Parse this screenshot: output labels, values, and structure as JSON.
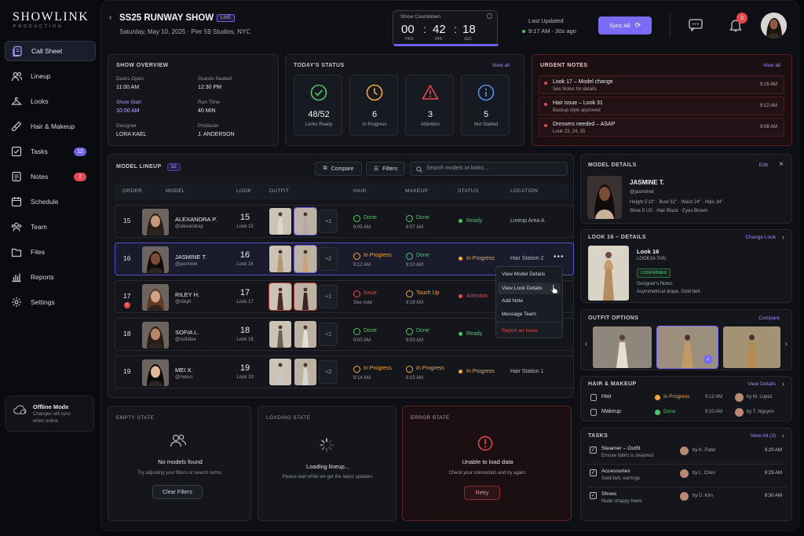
{
  "brand": {
    "name": "SHOWLINK",
    "sub": "PRODUCTION"
  },
  "sidebar": {
    "items": [
      {
        "label": "Call Sheet",
        "icon": "call-sheet-icon",
        "active": true
      },
      {
        "label": "Lineup",
        "icon": "users-icon"
      },
      {
        "label": "Looks",
        "icon": "hanger-icon"
      },
      {
        "label": "Hair & Makeup",
        "icon": "brush-icon"
      },
      {
        "label": "Tasks",
        "icon": "checkbox-icon",
        "badge": "12"
      },
      {
        "label": "Notes",
        "icon": "notes-icon",
        "badge": "2"
      },
      {
        "label": "Schedule",
        "icon": "calendar-icon"
      },
      {
        "label": "Team",
        "icon": "team-icon"
      },
      {
        "label": "Files",
        "icon": "folder-icon"
      },
      {
        "label": "Reports",
        "icon": "bar-chart-icon"
      },
      {
        "label": "Settings",
        "icon": "gear-icon"
      }
    ],
    "offline": {
      "title": "Offline Mode",
      "line1": "Changes will sync",
      "line2": "when online"
    }
  },
  "header": {
    "title": "SS25 RUNWAY SHOW",
    "live": "LIVE",
    "subtitle": "Saturday, May 10, 2025 · Pier 59 Studios, NYC",
    "countdown": {
      "label": "Show Countdown",
      "hrs": "00",
      "min": "42",
      "sec": "18",
      "hrs_label": "HRS",
      "min_label": "MIN",
      "sec_label": "SEC"
    },
    "updated": {
      "label": "Last Updated",
      "time": "9:17 AM · 30s ago"
    },
    "sync": "Sync All",
    "notif_count": "3"
  },
  "overview": {
    "title": "SHOW OVERVIEW",
    "fields": [
      {
        "label": "Doors Open",
        "value": "11:00 AM"
      },
      {
        "label": "Guests Seated",
        "value": "12:30 PM"
      },
      {
        "label": "Show Start",
        "value": "10:00 AM"
      },
      {
        "label": "Run Time",
        "value": "40 MIN"
      },
      {
        "label": "Designer",
        "value": "LORA KAEL"
      },
      {
        "label": "Producer",
        "value": "J. ANDERSON"
      }
    ]
  },
  "status": {
    "title": "TODAY'S STATUS",
    "link": "View all",
    "items": [
      {
        "value": "48/52",
        "label": "Looks Ready"
      },
      {
        "value": "6",
        "label": "In Progress"
      },
      {
        "value": "3",
        "label": "Attention"
      },
      {
        "value": "5",
        "label": "Not Started"
      }
    ]
  },
  "urgent": {
    "title": "URGENT NOTES",
    "link": "View all",
    "items": [
      {
        "title": "Look 17 – Model change",
        "sub": "See Notes for details",
        "time": "9:16 AM"
      },
      {
        "title": "Hair issue – Look 31",
        "sub": "Backup style approved",
        "time": "9:12 AM"
      },
      {
        "title": "Dressers needed – ASAP",
        "sub": "Look 23, 24, 25",
        "time": "9:08 AM"
      }
    ]
  },
  "lineup": {
    "title": "MODEL LINEUP",
    "count": "52",
    "compare": "Compare",
    "filters": "Filters",
    "search_placeholder": "Search models or looks...",
    "columns": [
      "ORDER",
      "MODEL",
      "LOOK",
      "OUTFIT",
      "HAIR",
      "MAKEUP",
      "STATUS",
      "LOCATION"
    ],
    "rows": [
      {
        "order": "15",
        "name": "ALEXANDRA P.",
        "handle": "@alexandrap",
        "look": "15",
        "look_label": "Look 15",
        "more": "+1",
        "hair": "Done",
        "hair_time": "9:05 AM",
        "makeup": "Done",
        "makeup_time": "9:07 AM",
        "status": "Ready",
        "location": "Lineup Area A"
      },
      {
        "order": "16",
        "name": "JASMINE T.",
        "handle": "@jasminet",
        "look": "16",
        "look_label": "Look 16",
        "more": "+2",
        "hair": "In Progress",
        "hair_time": "9:12 AM",
        "makeup": "Done",
        "makeup_time": "9:10 AM",
        "status": "In Progress",
        "location": "Hair Station 2"
      },
      {
        "order": "17",
        "name": "RILEY H.",
        "handle": "@rileyh",
        "look": "17",
        "look_label": "Look 17",
        "more": "+1",
        "hair": "Issue",
        "hair_time": "See note",
        "makeup": "Touch Up",
        "makeup_time": "9:18 AM",
        "status": "Attention",
        "location": "",
        "flag": "!"
      },
      {
        "order": "18",
        "name": "SOFIA L.",
        "handle": "@sofialee",
        "look": "18",
        "look_label": "Look 18",
        "more": "+1",
        "hair": "Done",
        "hair_time": "9:00 AM",
        "makeup": "Done",
        "makeup_time": "9:03 AM",
        "status": "Ready",
        "location": ""
      },
      {
        "order": "19",
        "name": "MEI X.",
        "handle": "@meixu",
        "look": "19",
        "look_label": "Look 19",
        "more": "+2",
        "hair": "In Progress",
        "hair_time": "9:14 AM",
        "makeup": "In Progress",
        "makeup_time": "9:15 AM",
        "status": "In Progress",
        "location": "Hair Station 1"
      }
    ],
    "menu": [
      "View Model Details",
      "View Look Details",
      "Add Note",
      "Message Team",
      "Report an Issue"
    ]
  },
  "states": {
    "empty": {
      "title": "EMPTY STATE",
      "heading": "No models found",
      "text": "Try adjusting your filters or search terms.",
      "button": "Clear Filters"
    },
    "loading": {
      "title": "LOADING STATE",
      "heading": "Loading lineup...",
      "text": "Please wait while we get the latest updates."
    },
    "error": {
      "title": "ERROR STATE",
      "heading": "Unable to load data",
      "text": "Check your connection and try again.",
      "button": "Retry"
    }
  },
  "model_details": {
    "title": "MODEL DETAILS",
    "edit": "Edit",
    "name": "JASMINE T.",
    "handle": "@jasminet",
    "line1": "Height 5'10\" · Bust 32\" · Waist 24\" · Hips 34\"",
    "line2": "Shoe 9 US · Hair Black · Eyes Brown"
  },
  "look_details": {
    "title": "LOOK 16 – DETAILS",
    "link": "Change Look",
    "name": "Look 16",
    "code": "LOOK16-TAN",
    "badge": "CONFIRMED",
    "notes_label": "Designer's Notes",
    "notes": "Asymmetrical drape. Gold belt."
  },
  "outfit_options": {
    "title": "OUTFIT OPTIONS",
    "link": "Compare"
  },
  "hair_makeup": {
    "title": "HAIR & MAKEUP",
    "link": "View Details",
    "rows": [
      {
        "label": "Hair",
        "status": "In Progress",
        "time": "9:12 AM",
        "by": "by M. Lopez"
      },
      {
        "label": "Makeup",
        "status": "Done",
        "time": "9:10 AM",
        "by": "by T. Nguyen"
      }
    ]
  },
  "tasks": {
    "title": "TASKS",
    "link": "View All (3)",
    "rows": [
      {
        "title": "Steamer – Outfit",
        "sub": "Ensure fabric is steamed",
        "by": "by K. Patel",
        "time": "9:20 AM"
      },
      {
        "title": "Accessories",
        "sub": "Gold belt, earrings",
        "by": "by L. Chen",
        "time": "9:25 AM"
      },
      {
        "title": "Shoes",
        "sub": "Nude strappy heels",
        "by": "by D. Kim",
        "time": "9:30 AM"
      }
    ]
  },
  "colors": {
    "accent": "#7b6cf6",
    "green": "#4ec46a",
    "amber": "#f2a93b",
    "red": "#e5484d",
    "blue": "#4f8fe6"
  }
}
